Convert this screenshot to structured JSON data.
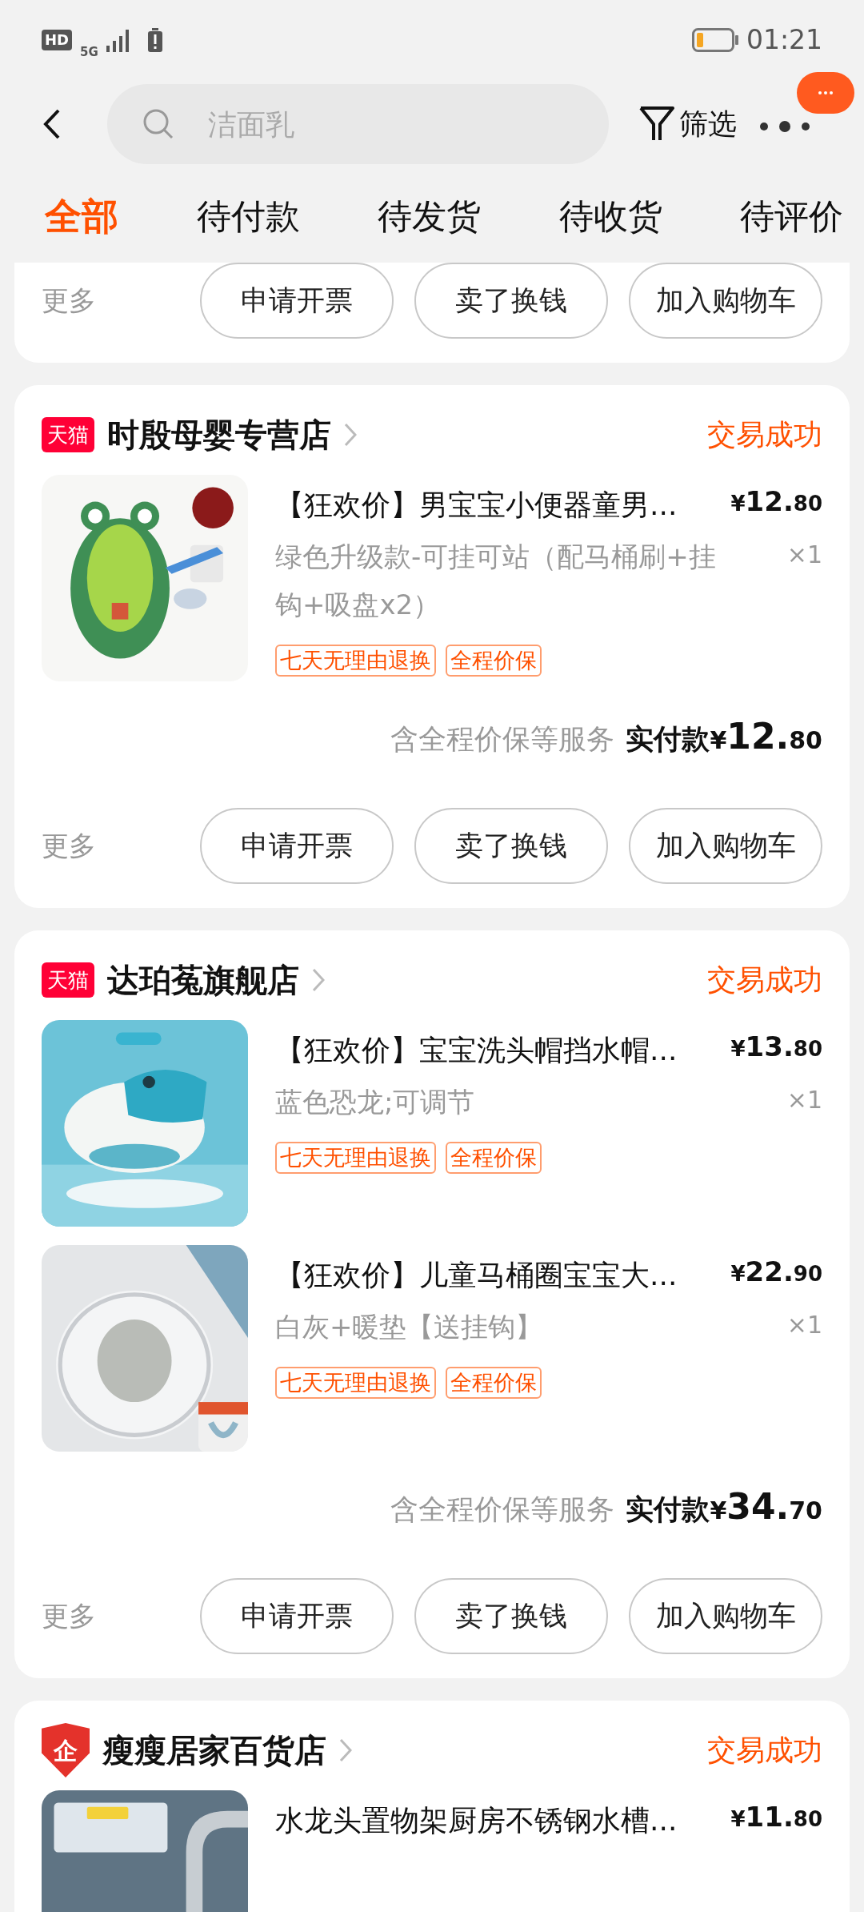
{
  "status_bar": {
    "network_badge": "HD",
    "network_type": "5G",
    "time": "01:21"
  },
  "header": {
    "search": {
      "placeholder": "洁面乳"
    },
    "filter_label": "筛选"
  },
  "tabs": [
    {
      "label": "全部",
      "selected": true
    },
    {
      "label": "待付款",
      "selected": false
    },
    {
      "label": "待发货",
      "selected": false
    },
    {
      "label": "待收货",
      "selected": false
    },
    {
      "label": "待评价",
      "selected": false
    }
  ],
  "orders": [
    {
      "more_label": "更多",
      "actions": [
        "申请开票",
        "卖了换钱",
        "加入购物车"
      ]
    },
    {
      "store": {
        "kind": "tmall",
        "badge_text": "天猫",
        "name": "时殷母婴专营店"
      },
      "status": "交易成功",
      "items": [
        {
          "title": "【狂欢价】男宝宝小便器童男...",
          "variant": "绿色升级款-可挂可站（配马桶刷+挂钩+吸盘x2）",
          "tags": [
            "七天无理由退换",
            "全程价保"
          ],
          "price": {
            "symbol": "¥",
            "integer": "12.",
            "decimal": "80"
          },
          "quantity": "×1"
        }
      ],
      "summary": {
        "note": "含全程价保等服务",
        "label": "实付款",
        "symbol": "¥",
        "integer": "12.",
        "decimal": "80"
      },
      "more_label": "更多",
      "actions": [
        "申请开票",
        "卖了换钱",
        "加入购物车"
      ]
    },
    {
      "store": {
        "kind": "tmall",
        "badge_text": "天猫",
        "name": "达珀菟旗舰店"
      },
      "status": "交易成功",
      "items": [
        {
          "title": "【狂欢价】宝宝洗头帽挡水帽...",
          "variant": "蓝色恐龙;可调节",
          "tags": [
            "七天无理由退换",
            "全程价保"
          ],
          "price": {
            "symbol": "¥",
            "integer": "13.",
            "decimal": "80"
          },
          "quantity": "×1"
        },
        {
          "title": "【狂欢价】儿童马桶圈宝宝大...",
          "variant": "白灰+暖垫【送挂钩】",
          "tags": [
            "七天无理由退换",
            "全程价保"
          ],
          "price": {
            "symbol": "¥",
            "integer": "22.",
            "decimal": "90"
          },
          "quantity": "×1"
        }
      ],
      "summary": {
        "note": "含全程价保等服务",
        "label": "实付款",
        "symbol": "¥",
        "integer": "34.",
        "decimal": "70"
      },
      "more_label": "更多",
      "actions": [
        "申请开票",
        "卖了换钱",
        "加入购物车"
      ]
    },
    {
      "store": {
        "kind": "enterprise",
        "badge_text": "企",
        "name": "瘦瘦居家百货店"
      },
      "status": "交易成功",
      "items": [
        {
          "title": "水龙头置物架厨房不锈钢水槽...",
          "price": {
            "symbol": "¥",
            "integer": "11.",
            "decimal": "80"
          }
        }
      ]
    }
  ]
}
